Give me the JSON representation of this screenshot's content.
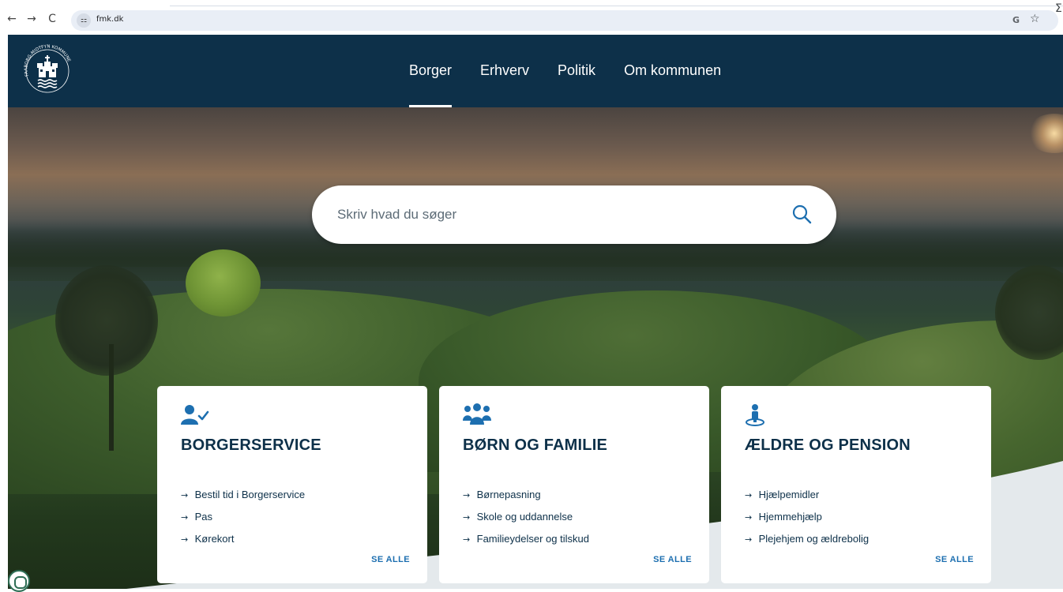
{
  "browser": {
    "back_icon": "←",
    "forward_icon": "→",
    "reload_icon": "C",
    "site_info_icon": "⚏",
    "url": "fmk.dk",
    "google_icon": "G",
    "star_icon": "☆",
    "extension_icon": "Σ"
  },
  "header": {
    "logo_icon": "faaborg-midtfyn-kommune-logo",
    "logo_text": "FAABORG-MIDTFYN KOMMUNE",
    "nav": [
      {
        "label": "Borger",
        "active": true
      },
      {
        "label": "Erhverv",
        "active": false
      },
      {
        "label": "Politik",
        "active": false
      },
      {
        "label": "Om kommunen",
        "active": false
      }
    ]
  },
  "search": {
    "placeholder": "Skriv hvad du søger",
    "icon": "search-icon"
  },
  "cards": [
    {
      "title": "BORGERSERVICE",
      "icon": "user-check-icon",
      "links": [
        "Bestil tid i Borgerservice",
        "Pas",
        "Kørekort"
      ],
      "see_all": "SE ALLE"
    },
    {
      "title": "BØRN OG FAMILIE",
      "icon": "family-group-icon",
      "links": [
        "Børnepasning",
        "Skole og uddannelse",
        "Familieydelser og tilskud"
      ],
      "see_all": "SE ALLE"
    },
    {
      "title": "ÆLDRE OG PENSION",
      "icon": "elderly-person-icon",
      "links": [
        "Hjælpemidler",
        "Hjemmehjælp",
        "Plejehjem og ældrebolig"
      ],
      "see_all": "SE ALLE"
    }
  ],
  "link_arrow": "→",
  "colors": {
    "navy": "#0d3049",
    "accent_blue": "#1d6fb0",
    "white": "#ffffff"
  }
}
